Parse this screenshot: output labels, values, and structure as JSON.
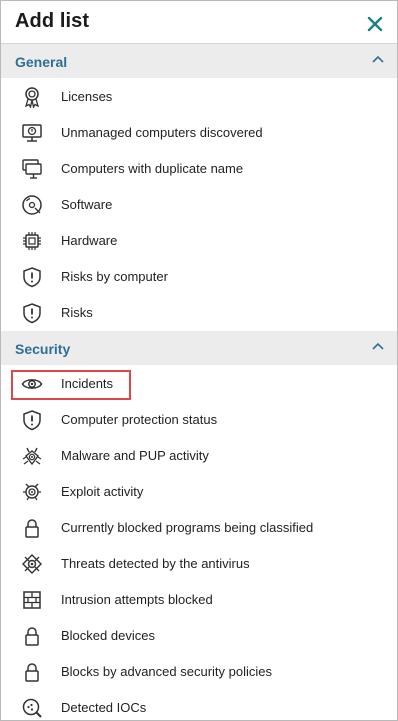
{
  "header": {
    "title": "Add list"
  },
  "sections": [
    {
      "label": "General",
      "items": [
        {
          "label": "Licenses",
          "icon": "license-badge-icon"
        },
        {
          "label": "Unmanaged computers discovered",
          "icon": "unmanaged-computer-icon"
        },
        {
          "label": "Computers with duplicate name",
          "icon": "duplicate-computers-icon"
        },
        {
          "label": "Software",
          "icon": "software-disc-icon"
        },
        {
          "label": "Hardware",
          "icon": "hardware-chip-icon"
        },
        {
          "label": "Risks by computer",
          "icon": "risk-shield-icon"
        },
        {
          "label": "Risks",
          "icon": "risk-shield-icon"
        }
      ]
    },
    {
      "label": "Security",
      "items": [
        {
          "label": "Incidents",
          "icon": "eye-icon"
        },
        {
          "label": "Computer protection status",
          "icon": "shield-alert-icon"
        },
        {
          "label": "Malware and PUP activity",
          "icon": "malware-icon"
        },
        {
          "label": "Exploit activity",
          "icon": "exploit-icon"
        },
        {
          "label": "Currently blocked programs being classified",
          "icon": "lock-icon"
        },
        {
          "label": "Threats detected by the antivirus",
          "icon": "threat-icon"
        },
        {
          "label": "Intrusion attempts blocked",
          "icon": "firewall-icon"
        },
        {
          "label": "Blocked devices",
          "icon": "lock-icon"
        },
        {
          "label": "Blocks by advanced security policies",
          "icon": "lock-icon"
        },
        {
          "label": "Detected IOCs",
          "icon": "ioc-search-icon"
        }
      ]
    }
  ],
  "colors": {
    "accent": "#2e6f97",
    "close": "#1f7f86",
    "highlight": "#e0454a",
    "section_bg": "#ececec"
  }
}
